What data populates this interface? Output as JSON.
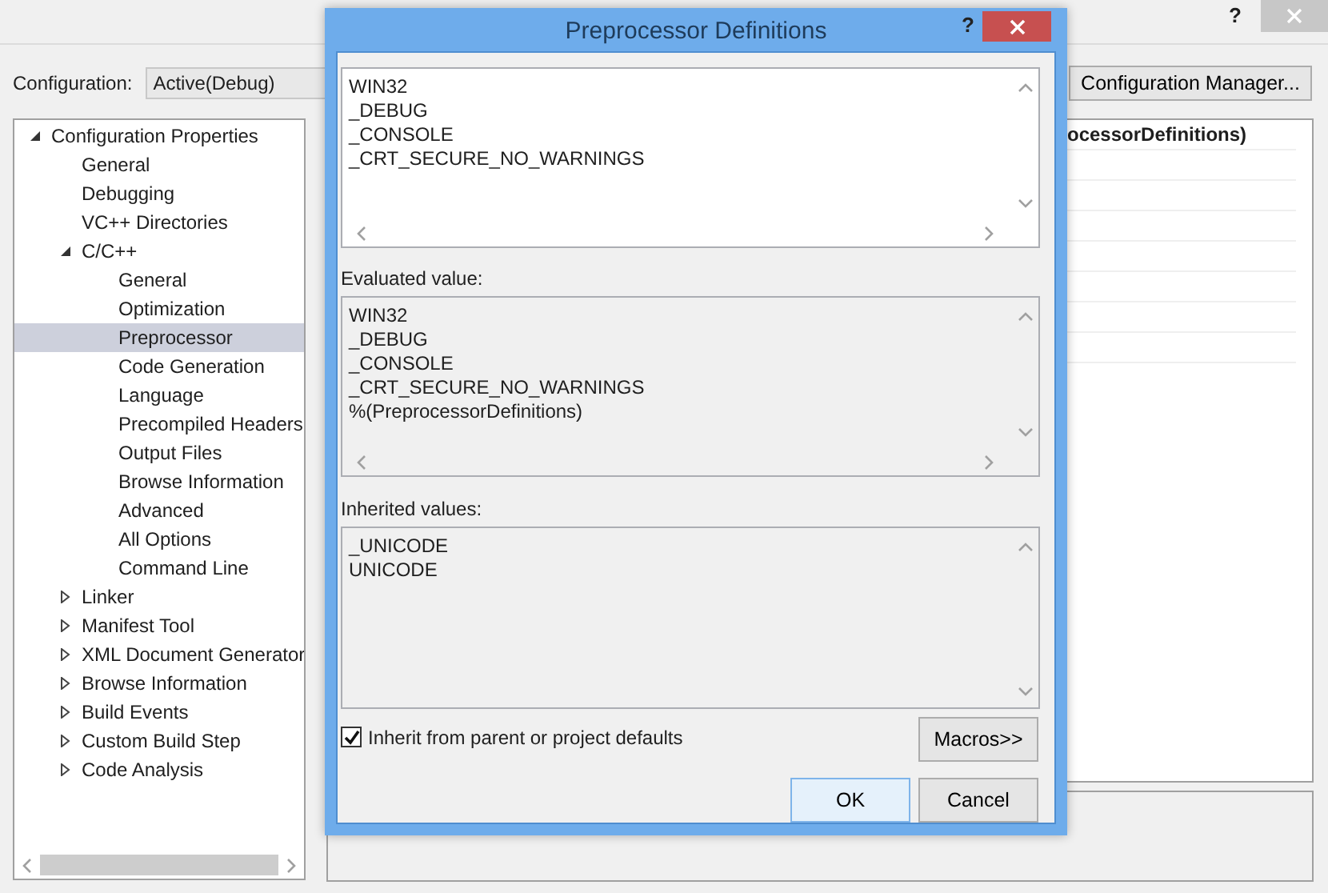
{
  "window": {
    "help": "?"
  },
  "configuration": {
    "label": "Configuration:",
    "value": "Active(Debug)",
    "manager_button": "Configuration Manager..."
  },
  "tree": [
    {
      "label": "Configuration Properties",
      "expanded": true,
      "selected": false,
      "children": [
        {
          "label": "General",
          "selected": false
        },
        {
          "label": "Debugging",
          "selected": false
        },
        {
          "label": "VC++ Directories",
          "selected": false
        },
        {
          "label": "C/C++",
          "expanded": true,
          "selected": false,
          "children": [
            {
              "label": "General",
              "selected": false
            },
            {
              "label": "Optimization",
              "selected": false
            },
            {
              "label": "Preprocessor",
              "selected": true
            },
            {
              "label": "Code Generation",
              "selected": false
            },
            {
              "label": "Language",
              "selected": false
            },
            {
              "label": "Precompiled Headers",
              "selected": false
            },
            {
              "label": "Output Files",
              "selected": false
            },
            {
              "label": "Browse Information",
              "selected": false
            },
            {
              "label": "Advanced",
              "selected": false
            },
            {
              "label": "All Options",
              "selected": false
            },
            {
              "label": "Command Line",
              "selected": false
            }
          ]
        },
        {
          "label": "Linker",
          "expanded": false,
          "selected": false
        },
        {
          "label": "Manifest Tool",
          "expanded": false,
          "selected": false
        },
        {
          "label": "XML Document Generator",
          "expanded": false,
          "selected": false
        },
        {
          "label": "Browse Information",
          "expanded": false,
          "selected": false
        },
        {
          "label": "Build Events",
          "expanded": false,
          "selected": false
        },
        {
          "label": "Custom Build Step",
          "expanded": false,
          "selected": false
        },
        {
          "label": "Code Analysis",
          "expanded": false,
          "selected": false
        }
      ]
    }
  ],
  "property_grid": {
    "visible_value": "ocessorDefinitions)"
  },
  "dialog": {
    "title": "Preprocessor Definitions",
    "help": "?",
    "definitions": [
      "WIN32",
      "_DEBUG",
      "_CONSOLE",
      "_CRT_SECURE_NO_WARNINGS"
    ],
    "evaluated_label": "Evaluated value:",
    "evaluated": [
      "WIN32",
      "_DEBUG",
      "_CONSOLE",
      "_CRT_SECURE_NO_WARNINGS",
      "%(PreprocessorDefinitions)"
    ],
    "inherited_label": "Inherited values:",
    "inherited": [
      "_UNICODE",
      "UNICODE"
    ],
    "inherit": {
      "label": "Inherit from parent or project defaults",
      "checked": true
    },
    "macros_button": "Macros>>",
    "buttons": [
      {
        "label": "OK",
        "default": true
      },
      {
        "label": "Cancel",
        "default": false
      }
    ]
  }
}
